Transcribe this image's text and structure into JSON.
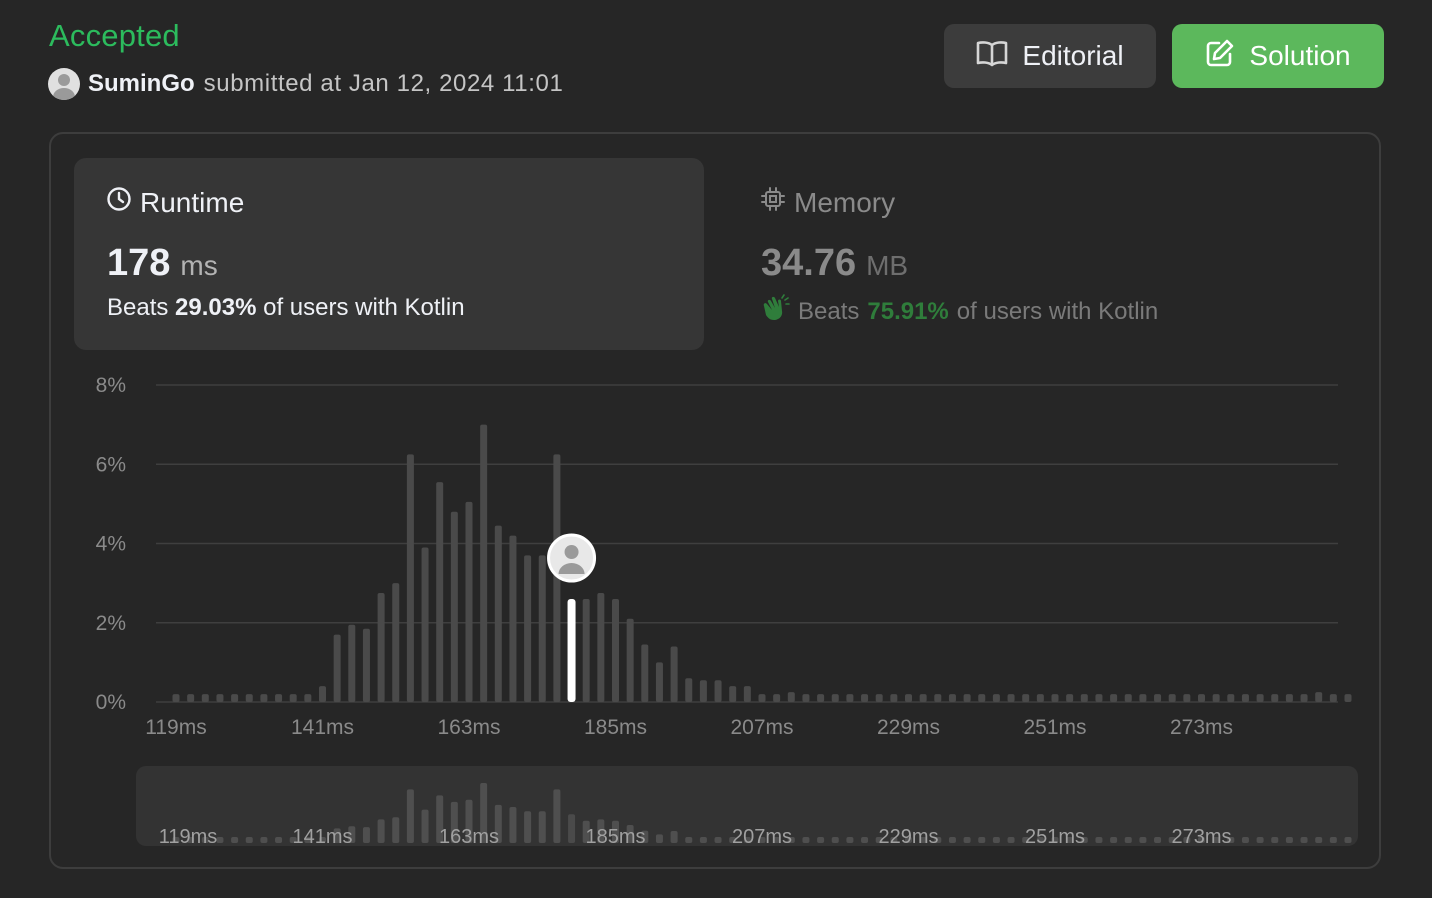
{
  "header": {
    "status": "Accepted",
    "username": "SuminGo",
    "submitted_text": "submitted at Jan 12, 2024 11:01",
    "status_color": "#2cbb5d"
  },
  "buttons": {
    "editorial_label": "Editorial",
    "editorial_icon": "book-open-icon",
    "solution_label": "Solution",
    "solution_icon": "edit-icon",
    "solution_color": "#5cb85c"
  },
  "runtime": {
    "label": "Runtime",
    "icon": "clock-icon",
    "value": "178",
    "unit": "ms",
    "beats_prefix": "Beats",
    "beats_pct": "29.03%",
    "beats_suffix": "of users with Kotlin"
  },
  "memory": {
    "label": "Memory",
    "icon": "chip-icon",
    "value": "34.76",
    "unit": "MB",
    "beats_icon": "clapping-hands-icon",
    "beats_prefix": "Beats",
    "beats_pct": "75.91%",
    "beats_suffix": "of users with Kotlin",
    "beats_color": "#2f7d3b"
  },
  "chart_data": {
    "type": "bar",
    "title": "",
    "xlabel": "",
    "ylabel": "",
    "ylim": [
      0,
      8
    ],
    "yticks": [
      "0%",
      "2%",
      "4%",
      "6%",
      "8%"
    ],
    "xticks": [
      "119ms",
      "141ms",
      "163ms",
      "185ms",
      "207ms",
      "229ms",
      "251ms",
      "273ms"
    ],
    "x_first_ms": 119,
    "x_step_ms": 2.2,
    "grid": true,
    "highlight_ms": 178,
    "highlight_value": 2.6,
    "values": [
      0.2,
      0.2,
      0.2,
      0.2,
      0.2,
      0.2,
      0.2,
      0.2,
      0.2,
      0.2,
      0.4,
      1.7,
      1.95,
      1.85,
      2.75,
      3.0,
      6.25,
      3.9,
      5.55,
      4.8,
      5.05,
      7.0,
      4.45,
      4.2,
      3.7,
      3.7,
      6.25,
      3.35,
      2.6,
      2.75,
      2.6,
      2.1,
      1.45,
      1.0,
      1.4,
      0.6,
      0.55,
      0.55,
      0.4,
      0.4,
      0.2,
      0.2,
      0.25,
      0.2,
      0.2,
      0.2,
      0.2,
      0.2,
      0.2,
      0.2,
      0.2,
      0.2,
      0.2,
      0.2,
      0.2,
      0.2,
      0.2,
      0.2,
      0.2,
      0.2,
      0.2,
      0.2,
      0.2,
      0.2,
      0.2,
      0.2,
      0.2,
      0.2,
      0.2,
      0.2,
      0.2,
      0.2,
      0.2,
      0.2,
      0.2,
      0.2,
      0.2,
      0.2,
      0.25,
      0.2,
      0.2
    ],
    "bar_color": "#4a4a4a",
    "highlight_color": "#ffffff"
  }
}
